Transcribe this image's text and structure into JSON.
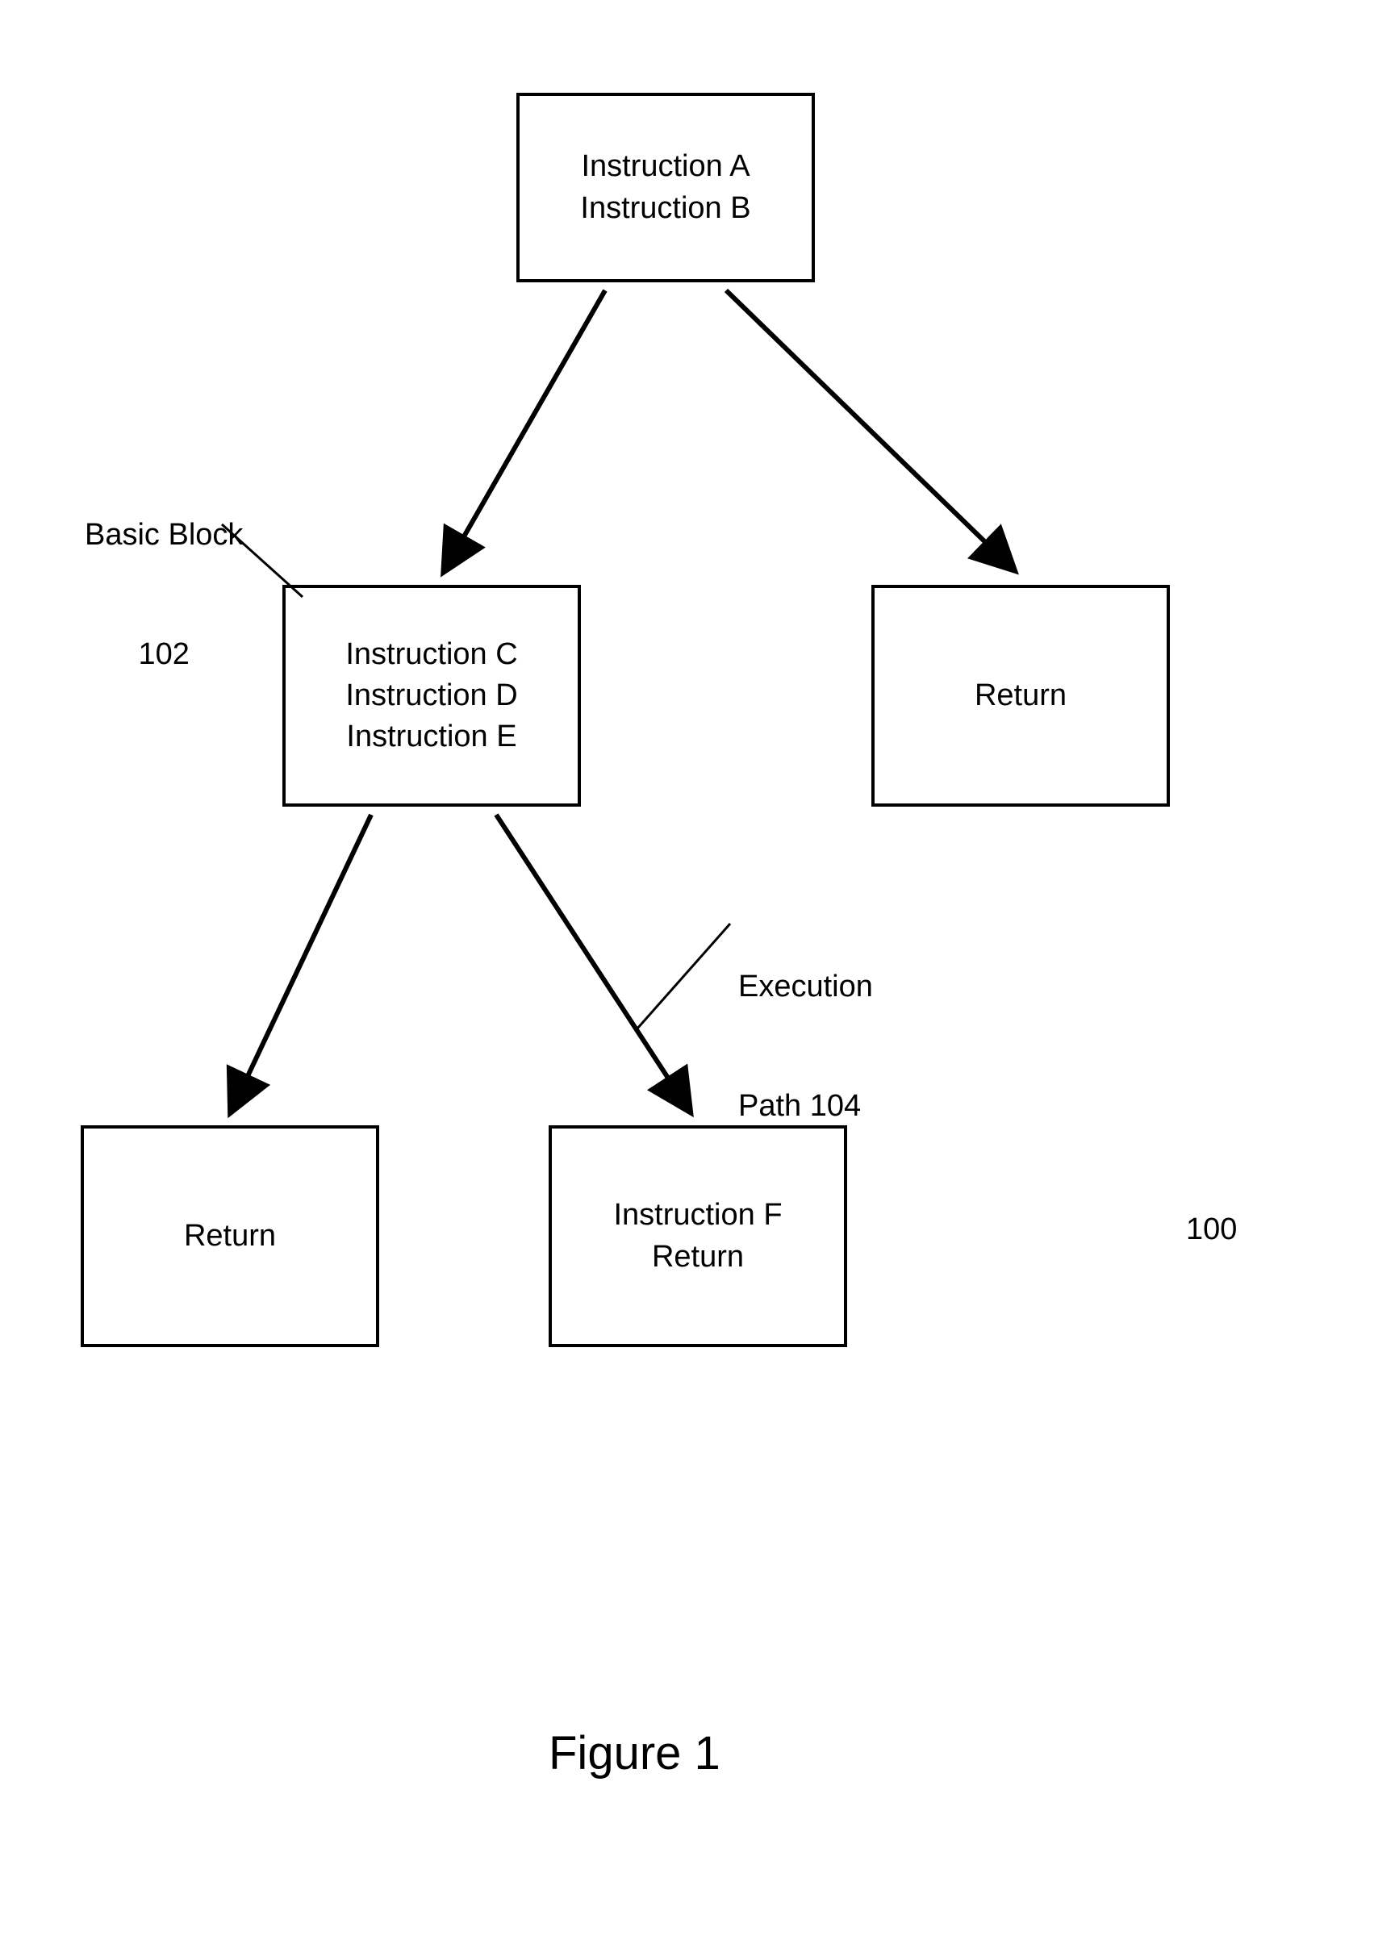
{
  "figure": {
    "caption": "Figure 1",
    "ref_number": "100"
  },
  "nodes": {
    "top": {
      "line1": "Instruction A",
      "line2": "Instruction B"
    },
    "left_mid": {
      "line1": "Instruction C",
      "line2": "Instruction D",
      "line3": "Instruction E"
    },
    "right_mid": {
      "line1": "Return"
    },
    "bottom_left": {
      "line1": "Return"
    },
    "bottom_right": {
      "line1": "Instruction F",
      "line2": "Return"
    }
  },
  "labels": {
    "basic_block": {
      "line1": "Basic Block",
      "line2": "102"
    },
    "execution_path": {
      "line1": "Execution",
      "line2": "Path 104"
    }
  }
}
